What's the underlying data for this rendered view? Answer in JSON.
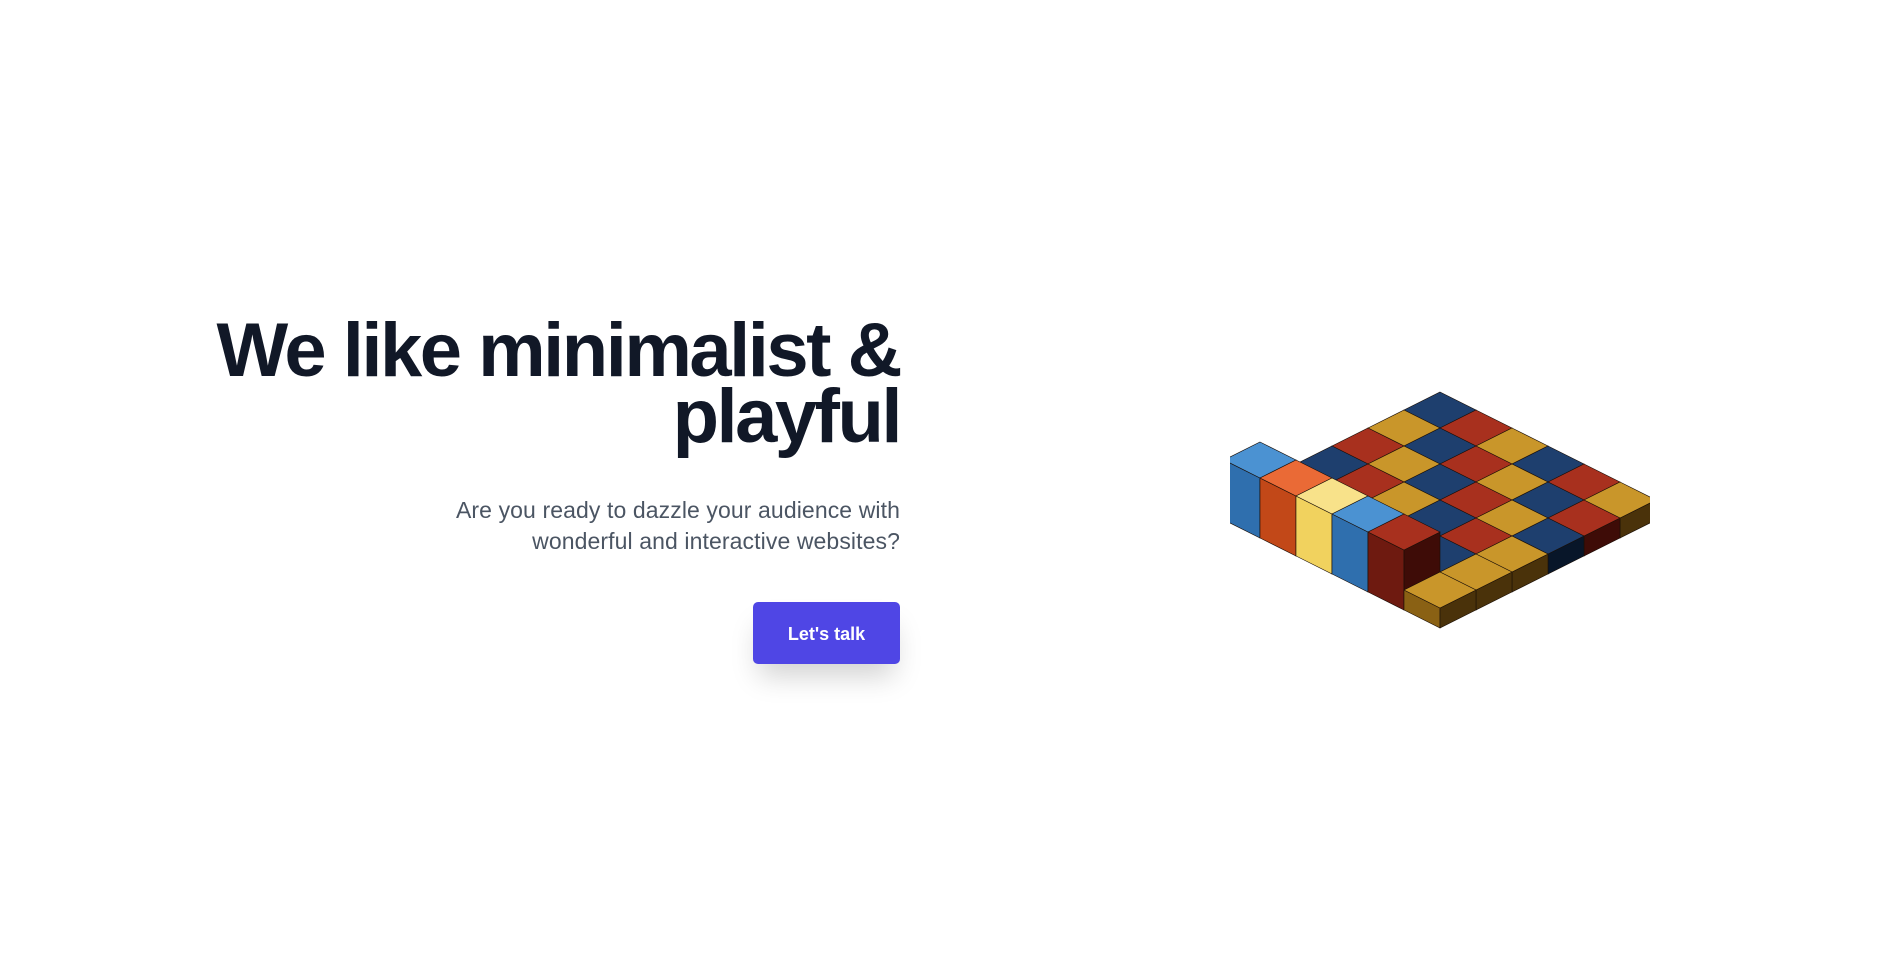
{
  "hero": {
    "headline_line1": "We like minimalist &",
    "headline_line2": "playful",
    "subtext_line1": "Are you ready to dazzle your audience with",
    "subtext_line2": "wonderful and interactive websites?",
    "cta_label": "Let's talk"
  },
  "colors": {
    "background": "#ffffff",
    "headline": "#111827",
    "subtext": "#4b5563",
    "cta_background": "#4f46e5",
    "cta_text": "#ffffff",
    "cube_palette": [
      "#3b82c4",
      "#e05a2b",
      "#f4e07a",
      "#a32a1a",
      "#c7931f",
      "#12355f"
    ]
  },
  "illustration": {
    "type": "isometric-cube-grid",
    "columns": 6,
    "rows": 6,
    "cells": [
      [
        "navy",
        "red",
        "gold",
        "navy",
        "red",
        "gold"
      ],
      [
        "gold",
        "navy",
        "red",
        "gold",
        "navy",
        "red"
      ],
      [
        "red",
        "gold",
        "navy",
        "red",
        "gold",
        "navy"
      ],
      [
        "navy",
        "red",
        "gold",
        "navy",
        "red",
        "gold"
      ],
      [
        "red",
        "navy",
        "red",
        "gold",
        "navy",
        "gold"
      ],
      [
        "blue",
        "orange",
        "yellow",
        "blue",
        "red",
        "gold"
      ]
    ],
    "raised": [
      [
        5,
        0
      ],
      [
        5,
        1
      ],
      [
        5,
        2
      ],
      [
        5,
        3
      ],
      [
        5,
        4
      ]
    ]
  }
}
